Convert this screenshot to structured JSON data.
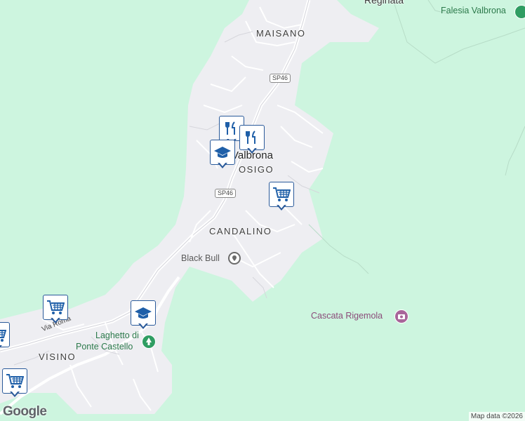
{
  "map": {
    "place_labels": [
      {
        "id": "reginata",
        "text": "Reginata"
      },
      {
        "id": "maisano",
        "text": "MAISANO"
      },
      {
        "id": "valbrona",
        "text": "Valbrona"
      },
      {
        "id": "osigo",
        "text": "OSIGO"
      },
      {
        "id": "candalino",
        "text": "CANDALINO"
      },
      {
        "id": "visino",
        "text": "VISINO"
      }
    ],
    "poi_labels": {
      "falesia": "Falesia Valbrona",
      "black_bull": "Black Bull",
      "cascata": "Cascata Rigemola",
      "laghetto_line1": "Laghetto di",
      "laghetto_line2": "Ponte Castello"
    },
    "street_labels": {
      "via_roma": "Via Roma"
    },
    "road_shields": [
      "SP46",
      "SP46"
    ],
    "markers": [
      {
        "id": "restaurant-1",
        "icon": "restaurant-icon"
      },
      {
        "id": "restaurant-2",
        "icon": "restaurant-icon"
      },
      {
        "id": "school-1",
        "icon": "school-icon"
      },
      {
        "id": "shop-1",
        "icon": "shopping-cart-icon"
      },
      {
        "id": "shop-2",
        "icon": "shopping-cart-icon"
      },
      {
        "id": "school-2",
        "icon": "school-icon"
      },
      {
        "id": "shop-3",
        "icon": "shopping-cart-icon"
      },
      {
        "id": "shop-4",
        "icon": "shopping-cart-icon"
      }
    ],
    "logo": "Google",
    "attribution": "Map data ©2026",
    "colors": {
      "background": "#cdf5df",
      "urban": "#eeeef2",
      "road": "#ffffff",
      "marker_border": "#2a5a9a",
      "marker_icon": "#1f5fa8",
      "poi_green": "#2c7a4b",
      "poi_pink": "#a8659a"
    }
  }
}
